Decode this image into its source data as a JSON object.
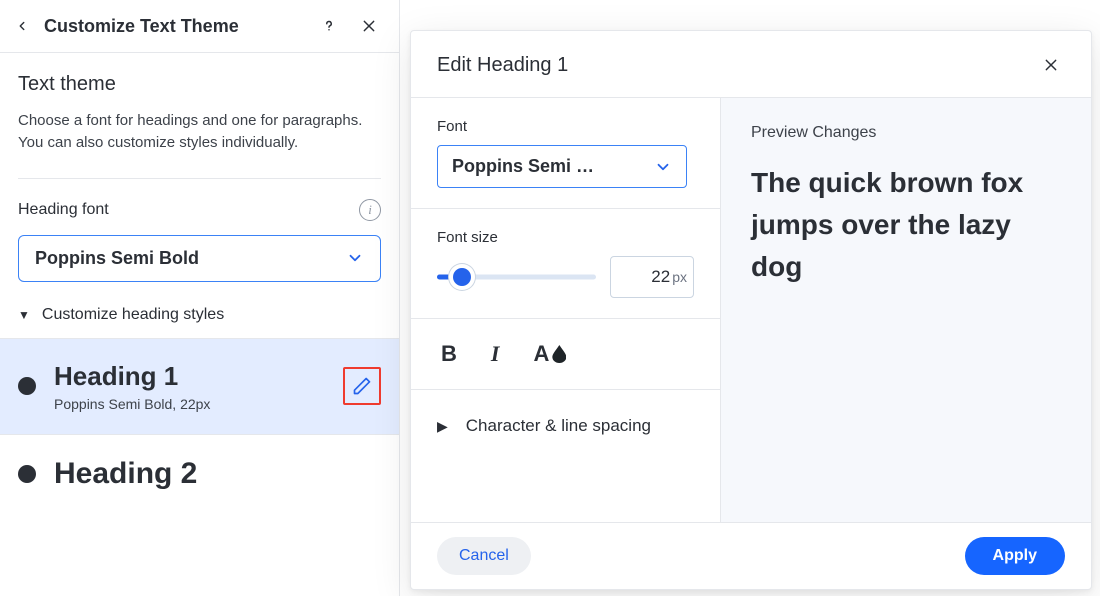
{
  "left": {
    "title": "Customize Text Theme",
    "section_title": "Text theme",
    "helper": "Choose a font for headings and one for paragraphs. You can also customize styles individually.",
    "heading_font_label": "Heading font",
    "heading_font_value": "Poppins Semi Bold",
    "customize_heading_styles": "Customize heading styles",
    "items": [
      {
        "title": "Heading 1",
        "sub": "Poppins Semi Bold, 22px"
      },
      {
        "title": "Heading 2",
        "sub": ""
      }
    ]
  },
  "modal": {
    "title": "Edit Heading 1",
    "font_label": "Font",
    "font_value": "Poppins Semi …",
    "font_size_label": "Font size",
    "font_size_value": "22",
    "font_size_unit": "px",
    "slider_percent": 16,
    "char_spacing_label": "Character & line spacing",
    "preview_label": "Preview Changes",
    "preview_text": "The quick brown fox jumps over the lazy dog",
    "cancel": "Cancel",
    "apply": "Apply"
  }
}
